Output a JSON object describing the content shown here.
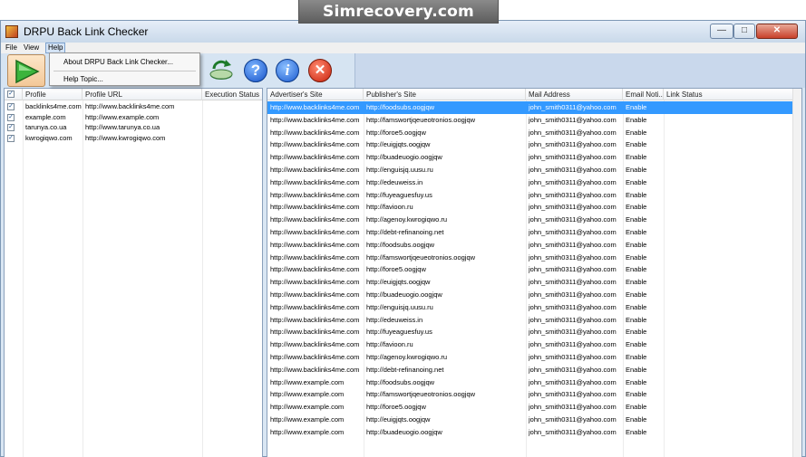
{
  "banner": {
    "text": "Simrecovery.com"
  },
  "window": {
    "title": "DRPU Back Link Checker"
  },
  "menu": {
    "file": "File",
    "view": "View",
    "help": "Help"
  },
  "help_menu": {
    "about": "About DRPU Back Link Checker...",
    "help_topic": "Help Topic..."
  },
  "toolbar": {
    "icons": [
      "play-icon",
      "refresh-icon",
      "help-icon",
      "info-icon",
      "exit-icon"
    ]
  },
  "left_table": {
    "columns": [
      "Profile",
      "Profile URL",
      "Execution Status"
    ],
    "rows": [
      {
        "profile": "backlinks4me.com",
        "url": "http://www.backlinks4me.com",
        "status": ""
      },
      {
        "profile": "example.com",
        "url": "http://www.example.com",
        "status": ""
      },
      {
        "profile": "tarunya.co.ua",
        "url": "http://www.tarunya.co.ua",
        "status": ""
      },
      {
        "profile": "kwrogiqwo.com",
        "url": "http://www.kwrogiqwo.com",
        "status": ""
      }
    ]
  },
  "right_table": {
    "columns": [
      "Advertiser's Site",
      "Publisher's Site",
      "Mail Address",
      "Email Noti...",
      "Link Status"
    ],
    "rows": [
      {
        "adv": "http://www.backlinks4me.com",
        "pub": "http://foodsubs.oogjqw",
        "mail": "john_smith0311@yahoo.com",
        "notify": "Enable",
        "status": ""
      },
      {
        "adv": "http://www.backlinks4me.com",
        "pub": "http://famswortjqeueotronios.oogjqw",
        "mail": "john_smith0311@yahoo.com",
        "notify": "Enable",
        "status": ""
      },
      {
        "adv": "http://www.backlinks4me.com",
        "pub": "http://foroe5.oogjqw",
        "mail": "john_smith0311@yahoo.com",
        "notify": "Enable",
        "status": ""
      },
      {
        "adv": "http://www.backlinks4me.com",
        "pub": "http://euigjqts.oogjqw",
        "mail": "john_smith0311@yahoo.com",
        "notify": "Enable",
        "status": ""
      },
      {
        "adv": "http://www.backlinks4me.com",
        "pub": "http://buadeuogio.oogjqw",
        "mail": "john_smith0311@yahoo.com",
        "notify": "Enable",
        "status": ""
      },
      {
        "adv": "http://www.backlinks4me.com",
        "pub": "http://enguisjq.uusu.ru",
        "mail": "john_smith0311@yahoo.com",
        "notify": "Enable",
        "status": ""
      },
      {
        "adv": "http://www.backlinks4me.com",
        "pub": "http://edeuweiss.in",
        "mail": "john_smith0311@yahoo.com",
        "notify": "Enable",
        "status": ""
      },
      {
        "adv": "http://www.backlinks4me.com",
        "pub": "http://fuyeaguesfuy.us",
        "mail": "john_smith0311@yahoo.com",
        "notify": "Enable",
        "status": ""
      },
      {
        "adv": "http://www.backlinks4me.com",
        "pub": "http://favioon.ru",
        "mail": "john_smith0311@yahoo.com",
        "notify": "Enable",
        "status": ""
      },
      {
        "adv": "http://www.backlinks4me.com",
        "pub": "http://agenoy.kwrogiqwo.ru",
        "mail": "john_smith0311@yahoo.com",
        "notify": "Enable",
        "status": ""
      },
      {
        "adv": "http://www.backlinks4me.com",
        "pub": "http://debt-refinanoing.net",
        "mail": "john_smith0311@yahoo.com",
        "notify": "Enable",
        "status": ""
      },
      {
        "adv": "http://www.backlinks4me.com",
        "pub": "http://foodsubs.oogjqw",
        "mail": "john_smith0311@yahoo.com",
        "notify": "Enable",
        "status": ""
      },
      {
        "adv": "http://www.backlinks4me.com",
        "pub": "http://famswortjqeueotronios.oogjqw",
        "mail": "john_smith0311@yahoo.com",
        "notify": "Enable",
        "status": ""
      },
      {
        "adv": "http://www.backlinks4me.com",
        "pub": "http://foroe5.oogjqw",
        "mail": "john_smith0311@yahoo.com",
        "notify": "Enable",
        "status": ""
      },
      {
        "adv": "http://www.backlinks4me.com",
        "pub": "http://euigjqts.oogjqw",
        "mail": "john_smith0311@yahoo.com",
        "notify": "Enable",
        "status": ""
      },
      {
        "adv": "http://www.backlinks4me.com",
        "pub": "http://buadeuogio.oogjqw",
        "mail": "john_smith0311@yahoo.com",
        "notify": "Enable",
        "status": ""
      },
      {
        "adv": "http://www.backlinks4me.com",
        "pub": "http://enguisjq.uusu.ru",
        "mail": "john_smith0311@yahoo.com",
        "notify": "Enable",
        "status": ""
      },
      {
        "adv": "http://www.backlinks4me.com",
        "pub": "http://edeuweiss.in",
        "mail": "john_smith0311@yahoo.com",
        "notify": "Enable",
        "status": ""
      },
      {
        "adv": "http://www.backlinks4me.com",
        "pub": "http://fuyeaguesfuy.us",
        "mail": "john_smith0311@yahoo.com",
        "notify": "Enable",
        "status": ""
      },
      {
        "adv": "http://www.backlinks4me.com",
        "pub": "http://favioon.ru",
        "mail": "john_smith0311@yahoo.com",
        "notify": "Enable",
        "status": ""
      },
      {
        "adv": "http://www.backlinks4me.com",
        "pub": "http://agenoy.kwrogiqwo.ru",
        "mail": "john_smith0311@yahoo.com",
        "notify": "Enable",
        "status": ""
      },
      {
        "adv": "http://www.backlinks4me.com",
        "pub": "http://debt-refinanoing.net",
        "mail": "john_smith0311@yahoo.com",
        "notify": "Enable",
        "status": ""
      },
      {
        "adv": "http://www.example.com",
        "pub": "http://foodsubs.oogjqw",
        "mail": "john_smith0311@yahoo.com",
        "notify": "Enable",
        "status": ""
      },
      {
        "adv": "http://www.example.com",
        "pub": "http://famswortjqeueotronios.oogjqw",
        "mail": "john_smith0311@yahoo.com",
        "notify": "Enable",
        "status": ""
      },
      {
        "adv": "http://www.example.com",
        "pub": "http://foroe5.oogjqw",
        "mail": "john_smith0311@yahoo.com",
        "notify": "Enable",
        "status": ""
      },
      {
        "adv": "http://www.example.com",
        "pub": "http://euigjqts.oogjqw",
        "mail": "john_smith0311@yahoo.com",
        "notify": "Enable",
        "status": ""
      },
      {
        "adv": "http://www.example.com",
        "pub": "http://buadeuogio.oogjqw",
        "mail": "john_smith0311@yahoo.com",
        "notify": "Enable",
        "status": ""
      }
    ]
  },
  "colors": {
    "selection": "#3399ff",
    "window_frame": "#d9e6f3"
  }
}
